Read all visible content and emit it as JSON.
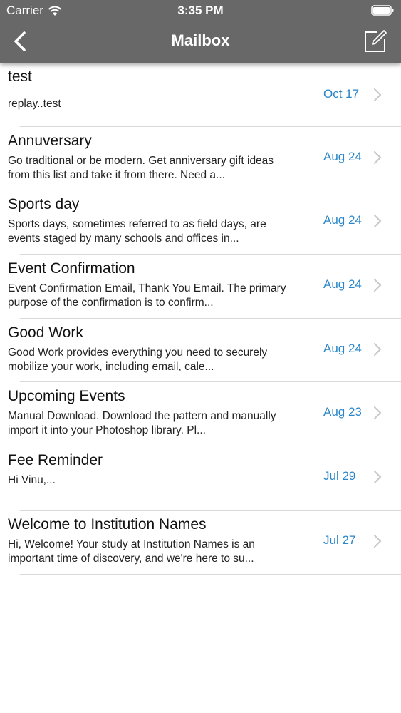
{
  "status_bar": {
    "carrier": "Carrier",
    "time": "3:35 PM"
  },
  "nav": {
    "title": "Mailbox",
    "back_icon": "chevron-left-icon",
    "compose_icon": "compose-icon"
  },
  "colors": {
    "bar": "#686868",
    "date": "#2a86c8",
    "separator": "#d9d9d9"
  },
  "mails": [
    {
      "subject": "test",
      "preview": "replay..test",
      "date": "Oct 17"
    },
    {
      "subject": "Annuversary",
      "preview": "Go traditional or be modern. Get anniversary gift ideas from this list and take it from there. Need a...",
      "date": "Aug 24"
    },
    {
      "subject": "Sports day",
      "preview": "Sports days, sometimes referred to as field days, are events staged by many schools and offices in...",
      "date": "Aug 24"
    },
    {
      "subject": "Event Confirmation",
      "preview": "Event Confirmation Email, Thank You Email. The primary purpose of the confirmation is to confirm...",
      "date": "Aug 24"
    },
    {
      "subject": "Good Work",
      "preview": "Good Work provides everything you need to securely mobilize your work, including email, cale...",
      "date": "Aug 24"
    },
    {
      "subject": "Upcoming Events",
      "preview": "Manual Download. Download the pattern and manually import it into your Photoshop library. Pl...",
      "date": "Aug 23"
    },
    {
      "subject": "Fee Reminder",
      "preview": "Hi Vinu,...",
      "date": "Jul 29"
    },
    {
      "subject": "Welcome to Institution Names",
      "preview": "Hi, Welcome! Your study at Institution Names is an important time of discovery, and we're here to su...",
      "date": "Jul 27"
    }
  ]
}
